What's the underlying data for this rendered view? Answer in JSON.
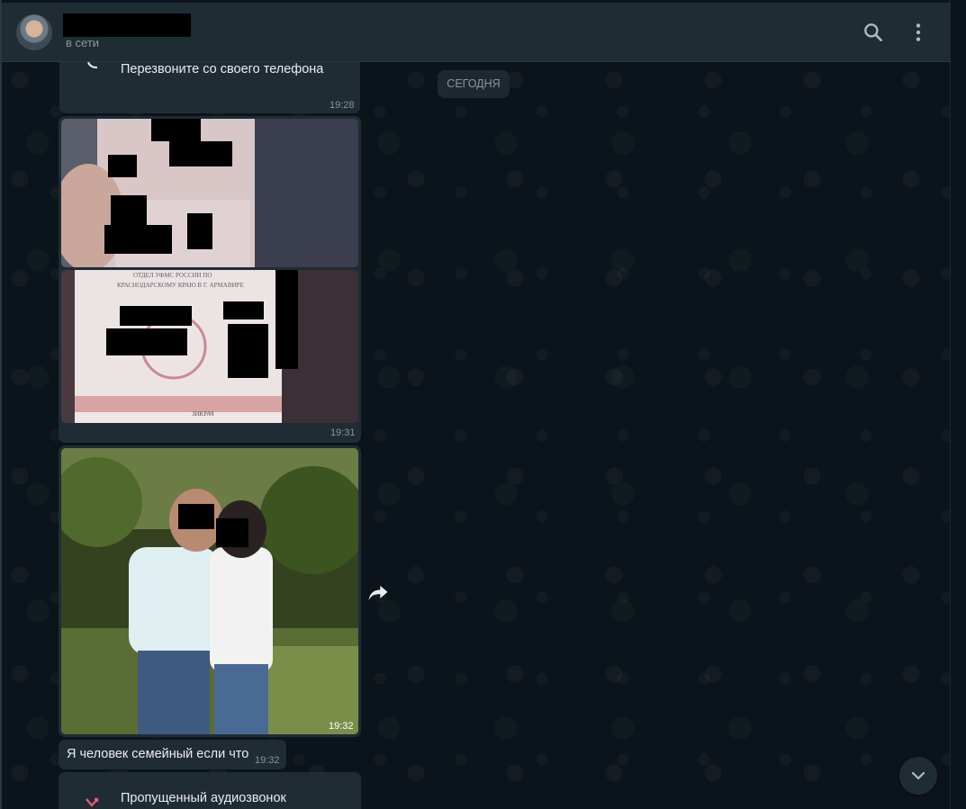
{
  "header": {
    "status": "в сети",
    "search_icon": "search-icon",
    "menu_icon": "more-vertical-icon"
  },
  "date_divider": "СЕГОДНЯ",
  "messages": [
    {
      "type": "call",
      "label": "Перезвоните со своего телефона",
      "time": "19:28"
    },
    {
      "type": "image-album",
      "count": 2,
      "time": "19:31"
    },
    {
      "type": "image",
      "time": "19:32"
    },
    {
      "type": "text",
      "text": "Я человек семейный если что",
      "time": "19:32"
    },
    {
      "type": "missed-call",
      "label": "Пропущенный аудиозвонок"
    }
  ],
  "colors": {
    "header_bg": "#202c33",
    "chat_bg": "#0b141a",
    "bubble_bg": "#202c33",
    "text_primary": "#e9edef",
    "text_secondary": "#8696a0",
    "missed_call": "#f15c6d"
  }
}
